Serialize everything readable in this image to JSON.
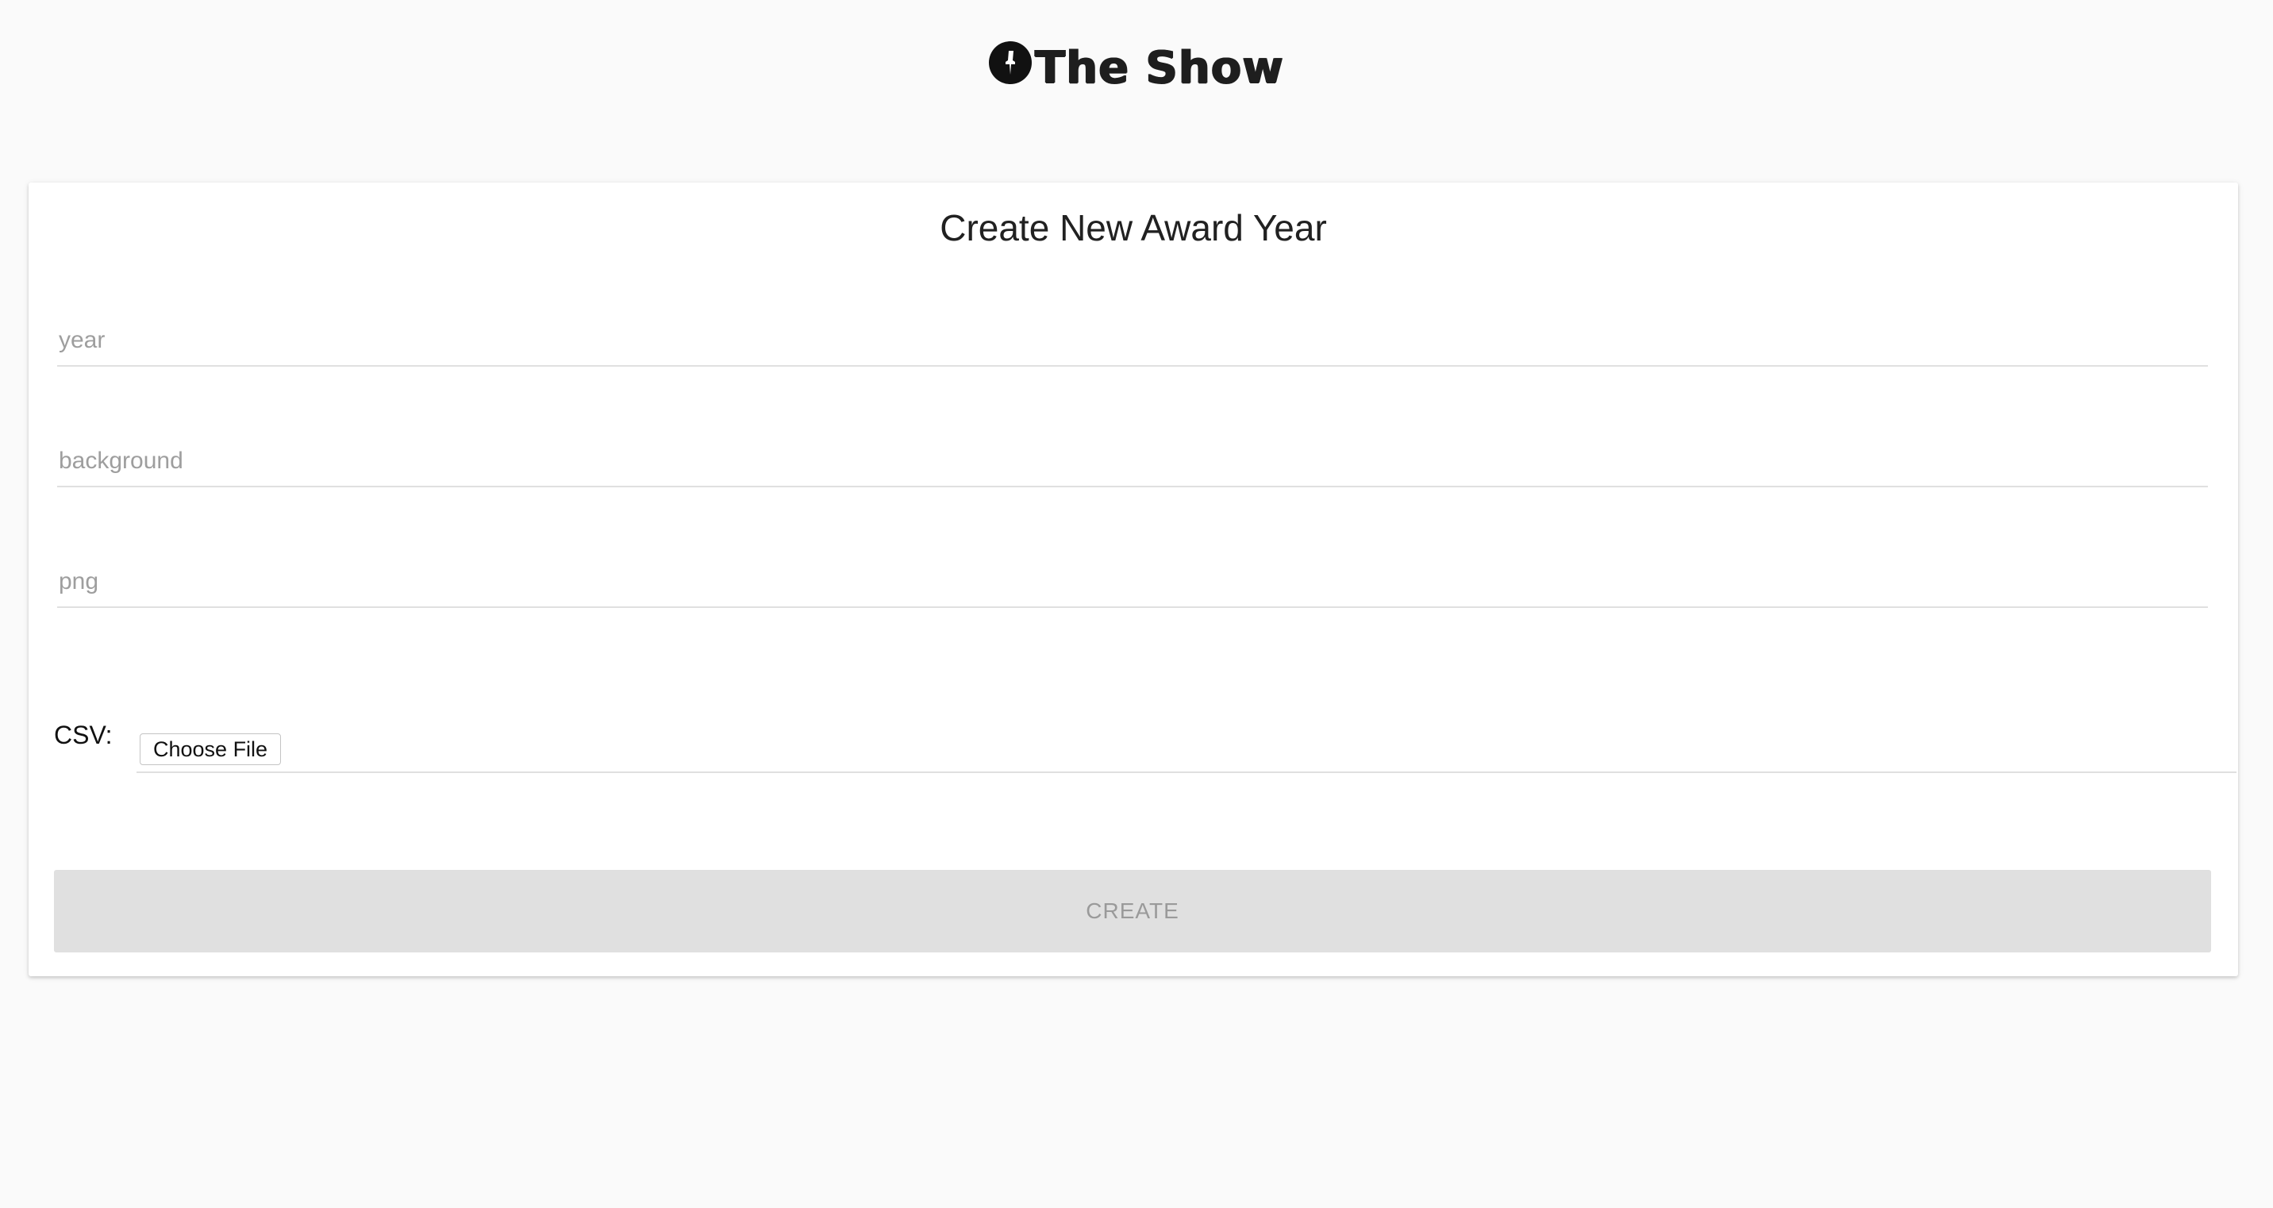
{
  "header": {
    "logo_icon": "pin-icon",
    "title": "The Show"
  },
  "form": {
    "title": "Create New Award Year",
    "fields": [
      {
        "placeholder": "year",
        "value": ""
      },
      {
        "placeholder": "background",
        "value": ""
      },
      {
        "placeholder": "png",
        "value": ""
      }
    ],
    "csv": {
      "label": "CSV:",
      "file_button_label": "Choose File"
    },
    "submit": {
      "label": "CREATE",
      "disabled": true
    }
  },
  "colors": {
    "background": "#fafafa",
    "card": "#ffffff",
    "underline": "#e0e0e0",
    "button_disabled": "#e0e0e0",
    "button_text_disabled": "#9a9a9a"
  }
}
